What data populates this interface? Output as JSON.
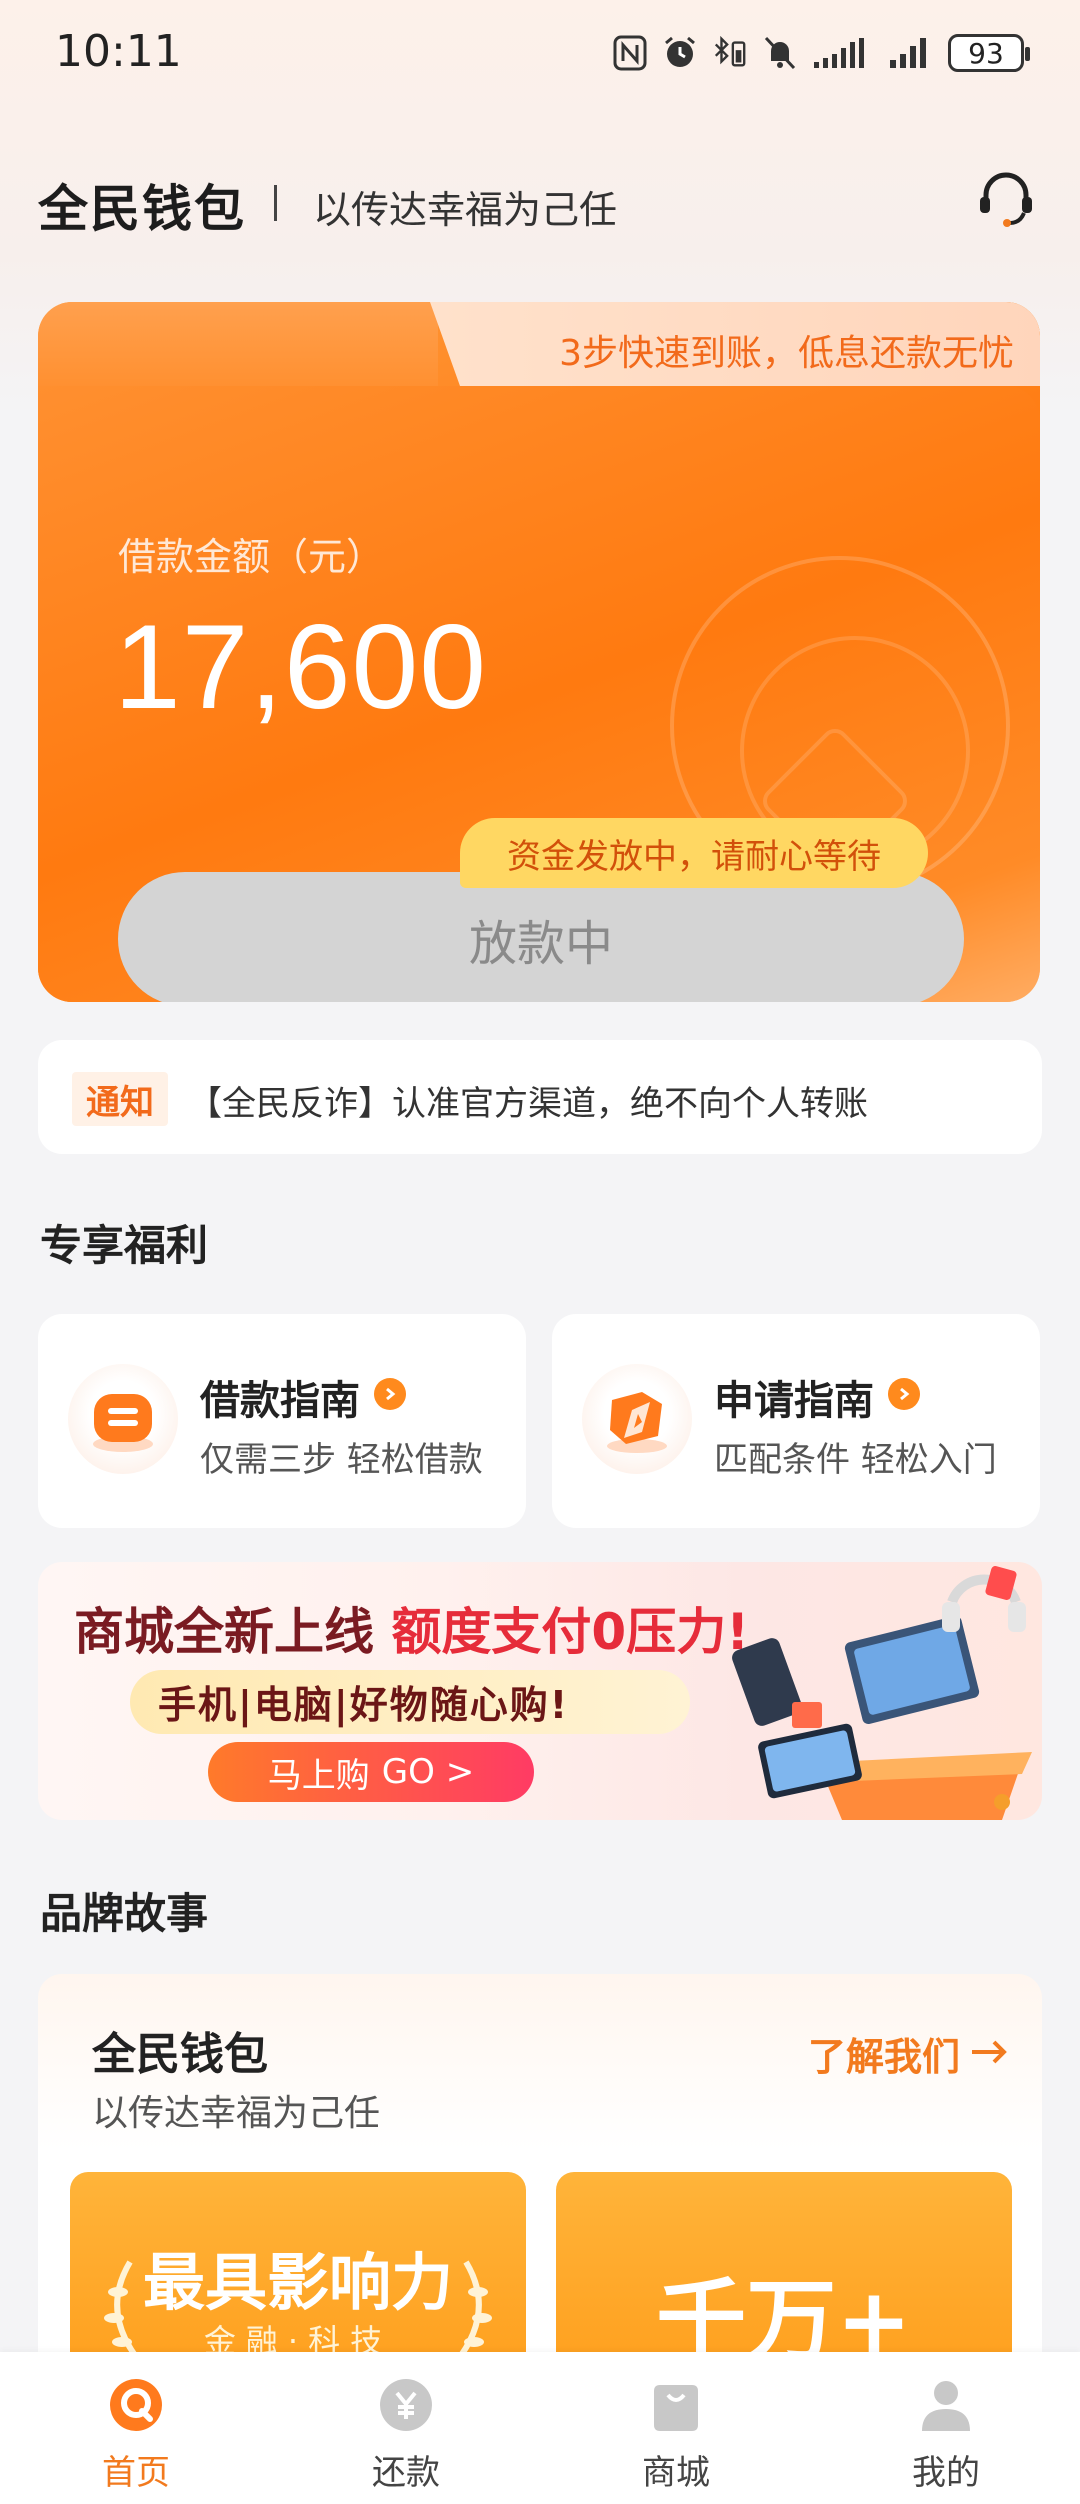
{
  "status_bar": {
    "time": "10:11",
    "battery": "93",
    "icons": [
      "nfc-icon",
      "alarm-icon",
      "bluetooth-battery-icon",
      "mute-icon",
      "signal-icon",
      "signal-icon"
    ]
  },
  "header": {
    "brand": "全民钱包",
    "slogan": "以传达幸福为己任",
    "service_icon": "customer-service-icon"
  },
  "loan_card": {
    "tab_text": "3步快速到账，低息还款无忧",
    "amount_label": "借款金额（元）",
    "amount_value": "17,600",
    "status_pill": "资金发放中，请耐心等待",
    "button_label": "放款中"
  },
  "notice": {
    "tag": "通知",
    "text": "【全民反诈】认准官方渠道，绝不向个人转账"
  },
  "benefits": {
    "title": "专享福利",
    "items": [
      {
        "title": "借款指南",
        "subtitle": "仅需三步 轻松借款",
        "icon": "loan-guide-icon"
      },
      {
        "title": "申请指南",
        "subtitle": "匹配条件 轻松入门",
        "icon": "apply-guide-icon"
      }
    ]
  },
  "banner": {
    "line1_a": "商城全新上线 ",
    "line1_b": "额度支付0压力!",
    "line2": "手机|电脑|好物随心购!",
    "cta": "马上购",
    "cta_go": "GO >"
  },
  "brand_story": {
    "title": "品牌故事",
    "card_title": "全民钱包",
    "card_sub": "以传达幸福为己任",
    "link": "了解我们",
    "tiles": [
      {
        "main": "最具影响力",
        "sub": "金融·科技"
      },
      {
        "main": "千万+"
      }
    ]
  },
  "bottom_nav": {
    "items": [
      {
        "label": "首页",
        "icon": "home-icon",
        "active": true
      },
      {
        "label": "还款",
        "icon": "repay-icon",
        "active": false
      },
      {
        "label": "商城",
        "icon": "shop-bag-icon",
        "active": false
      },
      {
        "label": "我的",
        "icon": "profile-icon",
        "active": false
      }
    ]
  },
  "colors": {
    "accent": "#ff7d14",
    "accent_text": "#f27a1e",
    "pill": "#ffd762",
    "disabled_button": "#d4d4d4"
  }
}
